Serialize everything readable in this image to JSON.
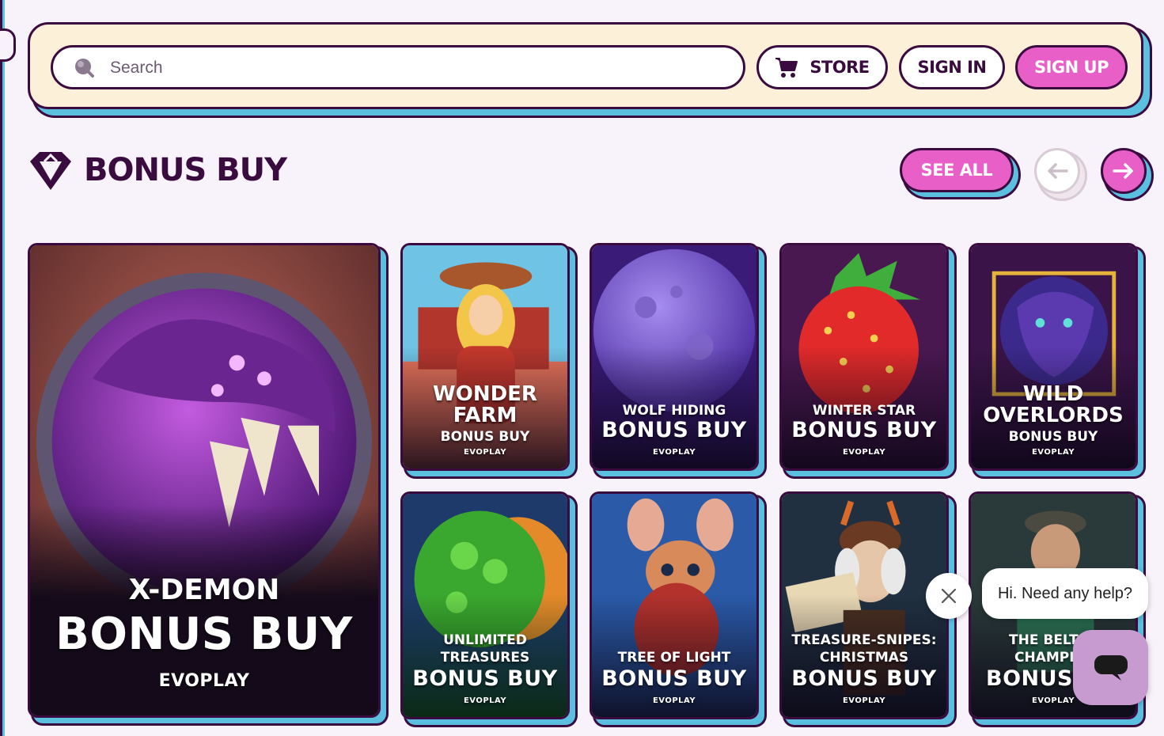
{
  "header": {
    "search_placeholder": "Search",
    "store_label": "STORE",
    "signin_label": "SIGN IN",
    "signup_label": "SIGN UP"
  },
  "section": {
    "title": "BONUS BUY",
    "see_all_label": "SEE ALL"
  },
  "featured": {
    "name": "X-DEMON",
    "subtitle": "BONUS BUY",
    "provider": "EVOPLAY"
  },
  "games": [
    {
      "name_lines": [
        "WONDER",
        "FARM"
      ],
      "subtitle": "BONUS BUY",
      "provider": "EVOPLAY"
    },
    {
      "name_lines": [
        "WOLF HIDING"
      ],
      "subtitle": "BONUS BUY",
      "provider": "EVOPLAY"
    },
    {
      "name_lines": [
        "WINTER STAR"
      ],
      "subtitle": "BONUS BUY",
      "provider": "EVOPLAY"
    },
    {
      "name_lines": [
        "WILD",
        "OVERLORDS"
      ],
      "subtitle": "BONUS BUY",
      "provider": "EVOPLAY"
    },
    {
      "name_lines": [
        "UNLIMITED",
        "TREASURES"
      ],
      "subtitle": "BONUS BUY",
      "provider": "EVOPLAY"
    },
    {
      "name_lines": [
        "TREE OF LIGHT"
      ],
      "subtitle": "BONUS BUY",
      "provider": "EVOPLAY"
    },
    {
      "name_lines": [
        "TREASURE-SNIPES:",
        "CHRISTMAS"
      ],
      "subtitle": "BONUS BUY",
      "provider": "EVOPLAY"
    },
    {
      "name_lines": [
        "THE BELT",
        "CHAMPI"
      ],
      "subtitle": "BONUS",
      "provider": "EVOPLAY"
    }
  ],
  "chat": {
    "message": "Hi. Need any help?"
  },
  "icons": {
    "search": "magnifier-icon",
    "store": "cart-icon",
    "section": "gem-icon",
    "prev": "arrow-left-icon",
    "next": "arrow-right-icon",
    "chat_close": "close-icon",
    "chat_launcher": "chat-icon"
  },
  "colors": {
    "accent_pink": "#e85fc8",
    "outline": "#3a0b3f",
    "shadow_blue": "#5bbfe0",
    "topbar_bg": "#fdf0d8"
  }
}
